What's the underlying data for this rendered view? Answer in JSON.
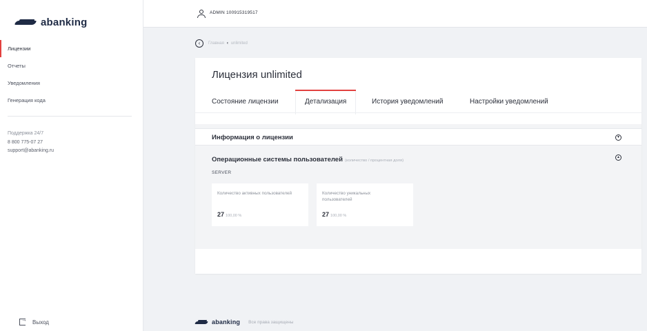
{
  "brand": {
    "name": "abanking"
  },
  "sidebar": {
    "items": [
      {
        "label": "Лицензии",
        "active": true
      },
      {
        "label": "Отчеты"
      },
      {
        "label": "Уведомления"
      },
      {
        "label": "Генерация кода"
      }
    ],
    "support": {
      "title": "Поддержка 24/7",
      "phone": "8 800 775-07 27",
      "email": "support@abanking.ru"
    },
    "logout_label": "Выход"
  },
  "header": {
    "user": "ADMIN 100915319517"
  },
  "breadcrumb": {
    "home": "Главная",
    "current": "unlimited"
  },
  "card": {
    "title": "Лицензия unlimited",
    "tabs": [
      {
        "label": "Состояние лицензии"
      },
      {
        "label": "Детализация",
        "active": true
      },
      {
        "label": "История уведомлений"
      },
      {
        "label": "Настройки уведомлений"
      }
    ],
    "license_info_title": "Информация о лицензии",
    "os_section": {
      "title": "Операционные системы пользователей",
      "hint": "(количество / процентная доля)",
      "group": "SERVER",
      "stats": [
        {
          "label": "Количество активных пользователей",
          "value": "27",
          "percent": "100,00 %"
        },
        {
          "label": "Количество уникальных пользователей",
          "value": "27",
          "percent": "100,00 %"
        }
      ]
    }
  },
  "footer": {
    "rights": "Все права защищены"
  },
  "colors": {
    "accent": "#e2413f",
    "brand": "#1f2b45"
  }
}
